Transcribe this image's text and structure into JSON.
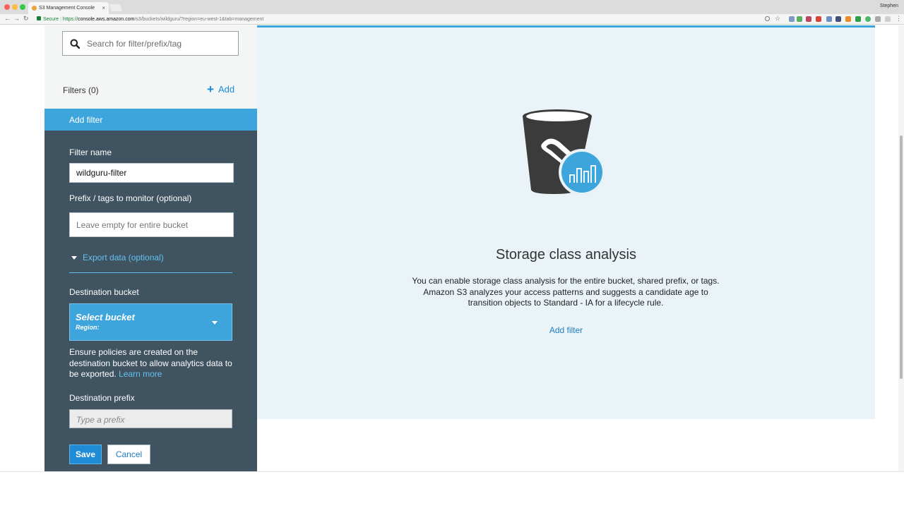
{
  "browser": {
    "tab_title": "S3 Management Console",
    "tab_close": "×",
    "profile_name": "Stephen",
    "secure_label": "Secure",
    "url_scheme": "https://",
    "url_host": "console.aws.amazon.com",
    "url_path": "/s3/buckets/wildguru/?region=eu-west-1&tab=management",
    "back_glyph": "←",
    "forward_glyph": "→",
    "reload_glyph": "↻"
  },
  "sidebar": {
    "search_placeholder": "Search for filter/prefix/tag",
    "filters_label": "Filters (0)",
    "add_plus": "+",
    "add_label": "Add"
  },
  "panel": {
    "header": "Add filter",
    "filter_name_label": "Filter name",
    "filter_name_value": "wildguru-filter",
    "prefix_label": "Prefix / tags to monitor (optional)",
    "prefix_placeholder": "Leave empty for entire bucket",
    "export_label": "Export data (optional)",
    "destination_bucket_label": "Destination bucket",
    "select_bucket_title": "Select bucket",
    "select_bucket_region": "Region:",
    "note_text": "Ensure policies are created on the destination bucket to allow analytics data to be exported. ",
    "learn_more": "Learn more",
    "destination_prefix_label": "Destination prefix",
    "destination_prefix_placeholder": "Type a prefix",
    "save_label": "Save",
    "cancel_label": "Cancel"
  },
  "main": {
    "title": "Storage class analysis",
    "description": "You can enable storage class analysis for the entire bucket, shared prefix, or tags. Amazon S3 analyzes your access patterns and suggests a candidate age to transition objects to Standard - IA for a lifecycle rule.",
    "add_filter": "Add filter"
  },
  "colors": {
    "accent_blue": "#3da5dc",
    "panel_dark": "#3f5361",
    "link_blue": "#1f7cc0",
    "main_bg": "#eaf4f8"
  },
  "icons": {
    "search": "search-icon",
    "plus": "plus-icon",
    "caret": "caret-down-icon",
    "illustration": "bucket-analytics-icon"
  }
}
